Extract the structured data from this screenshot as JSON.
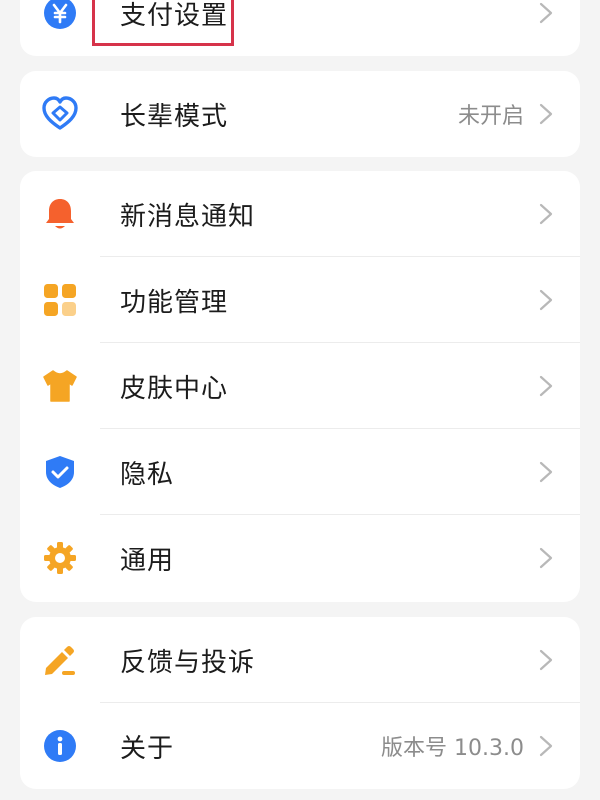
{
  "colors": {
    "background": "#f4f4f4",
    "card": "#ffffff",
    "label": "#1c1c1c",
    "value": "#8c8c8c",
    "chevron": "#b8b8b8",
    "highlight": "#d6334a"
  },
  "groups": [
    {
      "items": [
        {
          "label": "支付设置",
          "icon": "yuan-icon",
          "color": "#2f7bf6"
        }
      ]
    },
    {
      "items": [
        {
          "label": "长辈模式",
          "value": "未开启",
          "icon": "heart-hands-icon",
          "color": "#2f7bf6"
        }
      ]
    },
    {
      "items": [
        {
          "label": "新消息通知",
          "icon": "bell-icon",
          "color": "#f5612d"
        },
        {
          "label": "功能管理",
          "icon": "grid-icon",
          "color": "#f5a524"
        },
        {
          "label": "皮肤中心",
          "icon": "tshirt-icon",
          "color": "#f5a524"
        },
        {
          "label": "隐私",
          "icon": "shield-check-icon",
          "color": "#2f7bf6"
        },
        {
          "label": "通用",
          "icon": "gear-icon",
          "color": "#f5a524"
        }
      ]
    },
    {
      "items": [
        {
          "label": "反馈与投诉",
          "icon": "pen-icon",
          "color": "#f5a524"
        },
        {
          "label": "关于",
          "value": "版本号 10.3.0",
          "icon": "info-icon",
          "color": "#2f7bf6"
        }
      ]
    }
  ]
}
